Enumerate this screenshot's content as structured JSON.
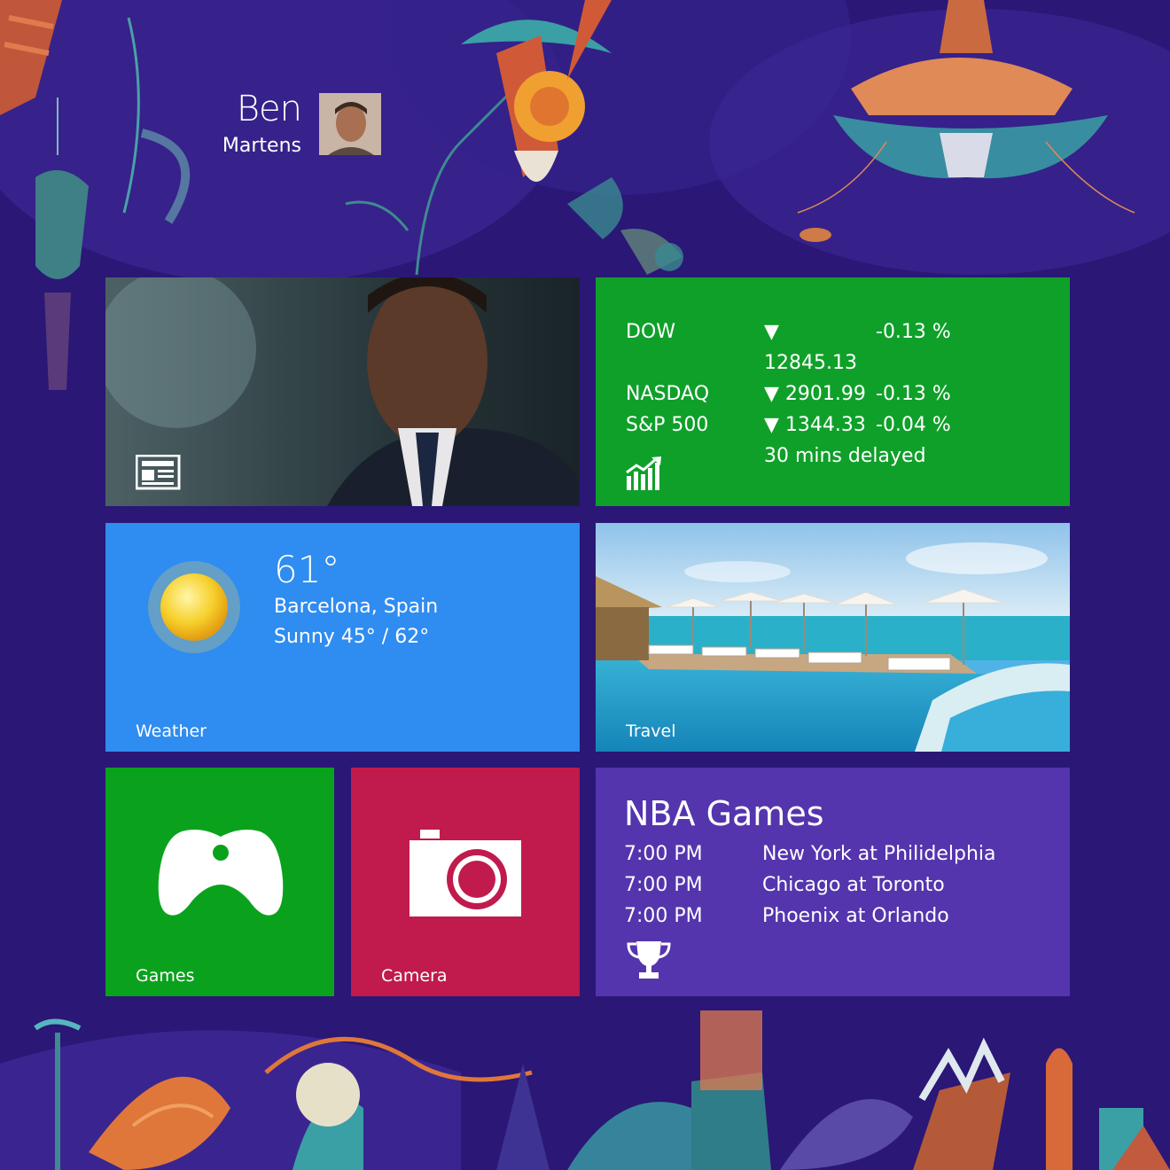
{
  "user": {
    "first_name": "Ben",
    "last_name": "Martens"
  },
  "tiles": {
    "news": {
      "icon": "newspaper-icon"
    },
    "finance": {
      "icon": "chart-icon",
      "rows": [
        {
          "name": "DOW",
          "value": "▼ 12845.13",
          "change": "-0.13 %"
        },
        {
          "name": "NASDAQ",
          "value": "▼ 2901.99",
          "change": "-0.13 %"
        },
        {
          "name": "S&P 500",
          "value": "▼ 1344.33",
          "change": "-0.04 %"
        }
      ],
      "note": "30 mins delayed"
    },
    "weather": {
      "label": "Weather",
      "temp": "61°",
      "location": "Barcelona, Spain",
      "condition": "Sunny  45° / 62°",
      "icon": "sun-icon"
    },
    "travel": {
      "label": "Travel"
    },
    "games": {
      "label": "Games",
      "icon": "controller-icon"
    },
    "camera": {
      "label": "Camera",
      "icon": "camera-icon"
    },
    "sports": {
      "title": "NBA Games",
      "icon": "trophy-icon",
      "games": [
        {
          "time": "7:00 PM",
          "match": "New York at Philidelphia"
        },
        {
          "time": "7:00 PM",
          "match": "Chicago at Toronto"
        },
        {
          "time": "7:00 PM",
          "match": "Phoenix at Orlando"
        }
      ]
    }
  },
  "colors": {
    "background": "#2a1776",
    "finance": "#0fa02a",
    "weather": "#2f8cf0",
    "games": "#0aa21c",
    "camera": "#c01b4c",
    "sports": "#5435ad"
  }
}
